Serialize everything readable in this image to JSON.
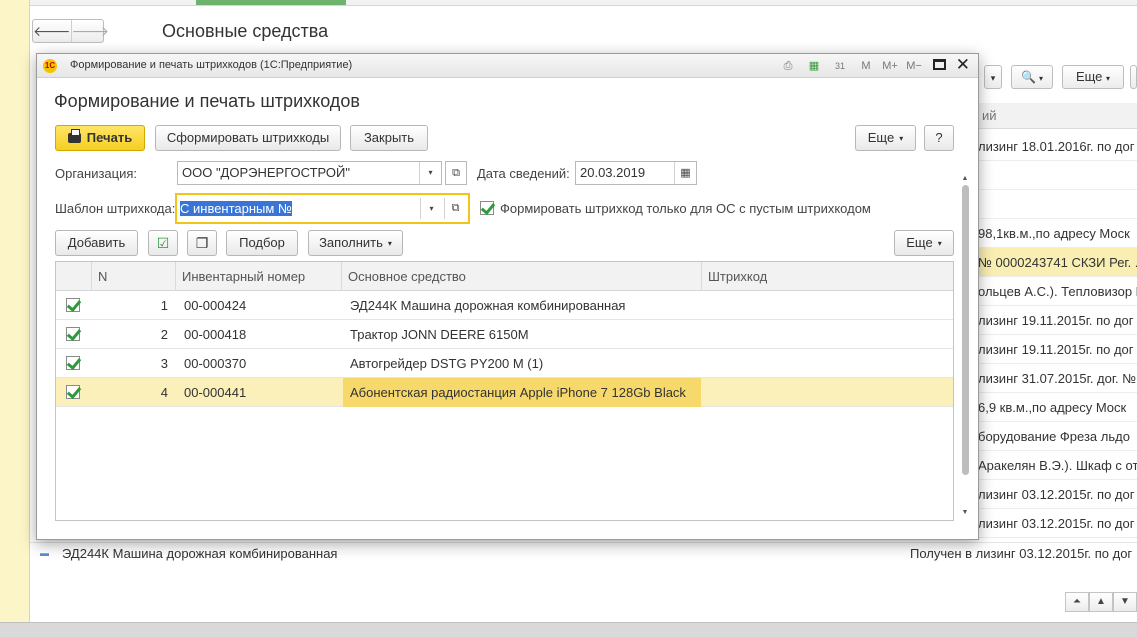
{
  "background": {
    "title": "Основные средства",
    "nav": {
      "back": "🡐",
      "forward": "🡒"
    },
    "more_label": "Еще",
    "dropdown_caret": "▾",
    "search_glyph": "🔍",
    "column_header_fragment": "ий",
    "rows": [
      {
        "text": "лизинг 18.01.2016г.  по дог"
      },
      {
        "text": ""
      },
      {
        "text": ""
      },
      {
        "text": "98,1кв.м.,по адресу  Моск"
      },
      {
        "text": "№ 0000243741 СКЗИ Рег. .",
        "selected": true
      },
      {
        "text": "ольцев А.С.). Тепловизор Flu"
      },
      {
        "text": "лизинг  19.11.2015г. по дог"
      },
      {
        "text": "лизинг  19.11.2015г. по дог"
      },
      {
        "text": "лизинг  31.07.2015г. дог. №"
      },
      {
        "text": "6,9 кв.м.,по адресу  Моск"
      },
      {
        "text": "борудование Фреза льдо"
      },
      {
        "text": "Аракелян В.Э.). Шкаф с отд"
      },
      {
        "text": "лизинг  03.12.2015г.  по  дог"
      },
      {
        "text": "лизинг  03.12.2015г.  по  дог"
      }
    ],
    "bottom_row": {
      "marker": "▬",
      "name": "ЭД244К Машина дорожная комбинированная",
      "status": "Получен в лизинг  03.12.2015г.  по  дог"
    },
    "scroll_buttons": [
      "⏶",
      "▲",
      "▼"
    ]
  },
  "window": {
    "logo": "1С",
    "caption": "Формирование и печать штрихкодов  (1С:Предприятие)",
    "titlebar_tools": [
      "⎙",
      "▦",
      "31",
      "M",
      "M+",
      "M−"
    ],
    "close_glyph": "✕"
  },
  "form": {
    "title": "Формирование и печать штрихкодов",
    "toolbar": {
      "print_label": "Печать",
      "generate_label": "Сформировать штрихкоды",
      "close_label": "Закрыть",
      "more_label": "Еще",
      "help_label": "?"
    },
    "organization": {
      "label": "Организация:",
      "value": "ООО \"ДОРЭНЕРГОСТРОЙ\""
    },
    "date": {
      "label": "Дата сведений:",
      "value": "20.03.2019",
      "calendar_glyph": "▦"
    },
    "template": {
      "label": "Шаблон штрихкода:",
      "value": "С инвентарным №"
    },
    "empty_only": {
      "label": "Формировать штрихкод только для ОС с пустым штрихкодом",
      "checked": true
    },
    "open_glyph": "⧉",
    "dropdown_caret": "▾",
    "table_toolbar": {
      "add_label": "Добавить",
      "check_all_glyph": "☑",
      "copy_glyph": "❐",
      "select_label": "Подбор",
      "fill_label": "Заполнить",
      "more_label": "Еще"
    },
    "table": {
      "columns": [
        "N",
        "Инвентарный номер",
        "Основное средство",
        "Штрихкод"
      ],
      "rows": [
        {
          "checked": true,
          "n": "1",
          "inv": "00-000424",
          "asset": "ЭД244К Машина дорожная комбинированная",
          "barcode": ""
        },
        {
          "checked": true,
          "n": "2",
          "inv": "00-000418",
          "asset": "Трактор JONN DEERE 6150M",
          "barcode": ""
        },
        {
          "checked": true,
          "n": "3",
          "inv": "00-000370",
          "asset": "Автогрейдер DSTG PY200 M (1)",
          "barcode": ""
        },
        {
          "checked": true,
          "n": "4",
          "inv": "00-000441",
          "asset": "Абонентская радиостанция Apple iPhone 7 128Gb Black",
          "barcode": "",
          "selected": true
        }
      ]
    },
    "scroll": {
      "up": "▲",
      "down": "▼"
    }
  }
}
